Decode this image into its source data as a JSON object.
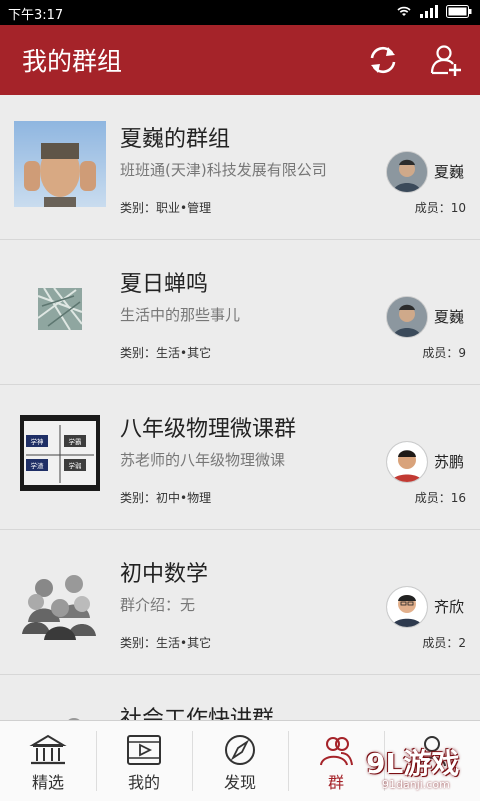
{
  "status_bar": {
    "time": "下午3:17"
  },
  "app_bar": {
    "title": "我的群组",
    "refresh_icon": "refresh-icon",
    "add_member_icon": "add-user-icon",
    "color": "#a52329"
  },
  "groups": [
    {
      "title": "夏巍的群组",
      "desc": "班班通(天津)科技发展有限公司",
      "category": "类别：职业•管理",
      "owner": "夏巍",
      "members": "成员：10"
    },
    {
      "title": "夏日蝉鸣",
      "desc": "生活中的那些事儿",
      "category": "类别：生活•其它",
      "owner": "夏巍",
      "members": "成员：9"
    },
    {
      "title": "八年级物理微课群",
      "desc": "苏老师的八年级物理微课",
      "category": "类别：初中•物理",
      "owner": "苏鹏",
      "members": "成员：16"
    },
    {
      "title": "初中数学",
      "desc": "群介绍：无",
      "category": "类别：生活•其它",
      "owner": "齐欣",
      "members": "成员：2"
    },
    {
      "title": "社会工作快讲群",
      "desc": "",
      "category": "",
      "owner": "",
      "members": ""
    }
  ],
  "thumb_labels": {
    "t1": "学神",
    "t2": "学霸",
    "t3": "学渣",
    "t4": "学弱"
  },
  "tabs": [
    {
      "label": "精选",
      "icon": "library-icon"
    },
    {
      "label": "我的",
      "icon": "video-icon"
    },
    {
      "label": "发现",
      "icon": "compass-icon"
    },
    {
      "label": "群",
      "icon": "group-icon"
    },
    {
      "label": "",
      "icon": "user-icon"
    }
  ],
  "watermark": {
    "text": "9L游戏",
    "url": "91danji.com"
  }
}
